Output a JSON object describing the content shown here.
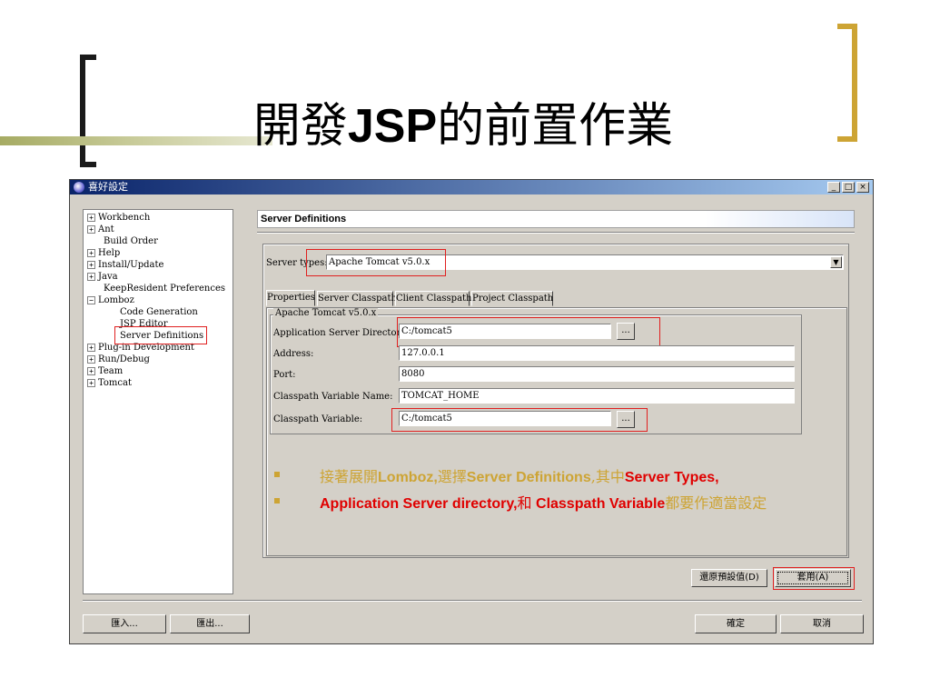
{
  "slide": {
    "title_cjk_1": "開發",
    "title_latin": "JSP",
    "title_cjk_2": "的前置作業"
  },
  "window": {
    "title": "喜好設定",
    "min_icon": "_",
    "max_icon": "□",
    "close_icon": "×"
  },
  "tree": {
    "items": [
      {
        "label": "Workbench",
        "expander": "+"
      },
      {
        "label": "Ant",
        "expander": "+"
      },
      {
        "label": "Build Order",
        "expander": ""
      },
      {
        "label": "Help",
        "expander": "+"
      },
      {
        "label": "Install/Update",
        "expander": "+"
      },
      {
        "label": "Java",
        "expander": "+"
      },
      {
        "label": "KeepResident Preferences",
        "expander": ""
      },
      {
        "label": "Lomboz",
        "expander": "−"
      },
      {
        "label": "Code Generation",
        "expander": ""
      },
      {
        "label": "JSP Editor",
        "expander": ""
      },
      {
        "label": "Server Definitions",
        "expander": ""
      },
      {
        "label": "Plug-in Development",
        "expander": "+"
      },
      {
        "label": "Run/Debug",
        "expander": "+"
      },
      {
        "label": "Team",
        "expander": "+"
      },
      {
        "label": "Tomcat",
        "expander": "+"
      }
    ]
  },
  "pane": {
    "header": "Server Definitions",
    "server_types_label": "Server types:",
    "server_types_value": "Apache Tomcat v5.0.x",
    "dropdown_icon": "▼",
    "tabs": [
      "Properties",
      "Server Classpath",
      "Client Classpath",
      "Project Classpath"
    ],
    "group_title": "Apache Tomcat v5.0.x",
    "fields": {
      "app_server_dir_label": "Application Server Directory:",
      "app_server_dir_value": "C:/tomcat5",
      "address_label": "Address:",
      "address_value": "127.0.0.1",
      "port_label": "Port:",
      "port_value": "8080",
      "cp_var_name_label": "Classpath Variable Name:",
      "cp_var_name_value": "TOMCAT_HOME",
      "cp_var_label": "Classpath Variable:",
      "cp_var_value": "C:/tomcat5",
      "browse_label": "..."
    },
    "restore_defaults": "還原預設值(D)",
    "apply": "套用(A)"
  },
  "bottom": {
    "import": "匯入...",
    "export": "匯出...",
    "ok": "確定",
    "cancel": "取消"
  },
  "bullets": {
    "b1_part1": "接著展開",
    "b1_part2": "Lomboz,",
    "b1_part3": "選擇",
    "b1_part4": "Server Definitions",
    "b1_part5": ",其中",
    "b1_part6": "Server Types,",
    "b2_part1": "Application Server directory,",
    "b2_part2": "和",
    "b2_part3": " Classpath Variable",
    "b2_part4": "都要作適當設定"
  },
  "colors": {
    "accent_gold": "#cda434",
    "highlight_red": "#e00000",
    "olive": "#a6ab63"
  }
}
